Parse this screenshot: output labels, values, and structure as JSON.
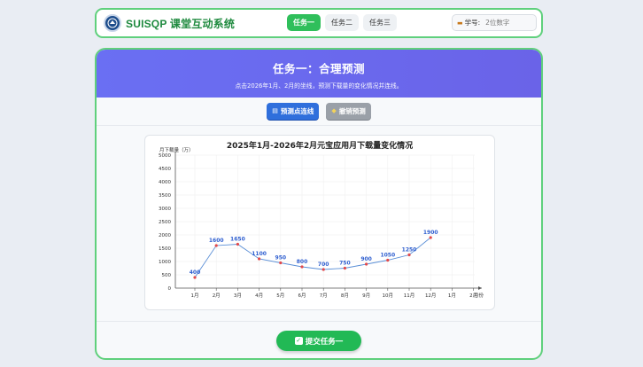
{
  "app": {
    "brand": "SUISQP 课堂互动系统"
  },
  "tabs": [
    {
      "label": "任务一",
      "active": true
    },
    {
      "label": "任务二",
      "active": false
    },
    {
      "label": "任务三",
      "active": false
    }
  ],
  "student_id": {
    "label": "学号:",
    "placeholder": "2位数字",
    "value": ""
  },
  "task": {
    "title": "任务一：合理预测",
    "subtitle": "点击2026年1月、2月的坐线，预测下载量的变化情况并连线。"
  },
  "buttons": {
    "predict": {
      "label": "预测点连线",
      "icon": "chart-icon"
    },
    "undo": {
      "label": "撤销预测",
      "icon": "eraser-icon"
    },
    "submit": {
      "label": "提交任务一",
      "icon": "check-icon"
    }
  },
  "colors": {
    "accent_green": "#2fbf5b",
    "header_purple": "#6a6ff3",
    "line_blue": "#5b8fd6",
    "point_red": "#e2494b",
    "label_blue": "#2f5fd0"
  },
  "chart_data": {
    "type": "line",
    "title": "2025年1月-2026年2月元宝应用月下载量变化情况",
    "ylabel": "月下载量（万）",
    "xlabel": "月份",
    "categories": [
      "1月",
      "2月",
      "3月",
      "4月",
      "5月",
      "6月",
      "7月",
      "8月",
      "9月",
      "10月",
      "11月",
      "12月",
      "1月",
      "2月"
    ],
    "series": [
      {
        "values": [
          400,
          1600,
          1650,
          1100,
          950,
          800,
          700,
          750,
          900,
          1050,
          1250,
          1900
        ]
      }
    ],
    "yticks": [
      0,
      500,
      1000,
      1500,
      2000,
      2500,
      3000,
      3500,
      4000,
      4500,
      5000
    ],
    "ylim": [
      0,
      5000
    ],
    "grid": true
  }
}
